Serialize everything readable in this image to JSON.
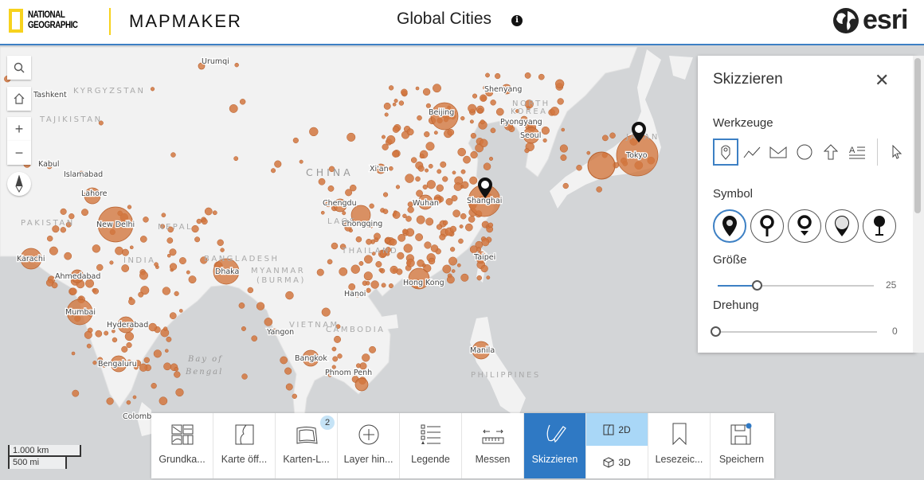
{
  "header": {
    "brand": [
      "NATIONAL",
      "GEOGRAPHIC"
    ],
    "app": "MAPMAKER",
    "title": "Global Cities",
    "info_icon": "info-icon",
    "esri": "esri"
  },
  "colors": {
    "accent": "#2f79c4",
    "city": "#d2773f",
    "land": "#f2f2f2",
    "water": "#d3d5d7"
  },
  "map": {
    "cities": [
      "Urumqi",
      "Tashkent",
      "Kabul",
      "Islamabad",
      "Lahore",
      "New Delhi",
      "Karachi",
      "Ahmedabad",
      "Mumbai",
      "Hyderabad",
      "Bengaluru",
      "Dhaka",
      "Yangon",
      "Bangkok",
      "Phnom Penh",
      "Hanoi",
      "Hong Kong",
      "Taipei",
      "Manila",
      "Chengdu",
      "Chongqing",
      "Xi'an",
      "Wuhan",
      "Shanghai",
      "Beijing",
      "Shenyang",
      "Pyongyang",
      "Seoul",
      "Tokyo",
      "Colombo"
    ],
    "countries": [
      "KYRGYZSTAN",
      "TAJIKISTAN",
      "PAKISTAN",
      "INDIA",
      "NEPAL",
      "BANGLADESH",
      "MYANMAR",
      "(BURMA)",
      "LAOS",
      "THAILAND",
      "VIETNAM",
      "CAMBODIA",
      "PHILIPPINES",
      "NORTH",
      "KOREA",
      "JAPAN"
    ],
    "china": "CHINA",
    "sea": [
      "Bay of",
      "Bengal"
    ],
    "markers": [
      "Shanghai",
      "Tokyo"
    ],
    "scale": {
      "km": "1.000 km",
      "mi": "500 mi"
    }
  },
  "controls": {
    "search": "search-icon",
    "home": "home-icon",
    "zoom_in": "+",
    "zoom_out": "−",
    "compass": "compass-icon"
  },
  "panel": {
    "title": "Skizzieren",
    "tools_heading": "Werkzeuge",
    "symbol_heading": "Symbol",
    "size_heading": "Größe",
    "size_value": "25",
    "size_fraction": 0.25,
    "rotation_heading": "Drehung",
    "rotation_value": "0",
    "rotation_fraction": 0,
    "tools": [
      "point",
      "polyline",
      "polygon",
      "circle",
      "arrow",
      "text",
      "select"
    ],
    "selected_tool": "point"
  },
  "toolbar": {
    "items": [
      {
        "label": "Grundka..."
      },
      {
        "label": "Karte öff..."
      },
      {
        "label": "Karten-L...",
        "badge": "2"
      },
      {
        "label": "Layer hin..."
      },
      {
        "label": "Legende"
      },
      {
        "label": "Messen"
      },
      {
        "label": "Skizzieren",
        "active": true
      }
    ],
    "dim2d": "2D",
    "dim3d": "3D",
    "dim_selected": "2D",
    "after": [
      {
        "label": "Lesezeic..."
      },
      {
        "label": "Speichern"
      }
    ]
  }
}
